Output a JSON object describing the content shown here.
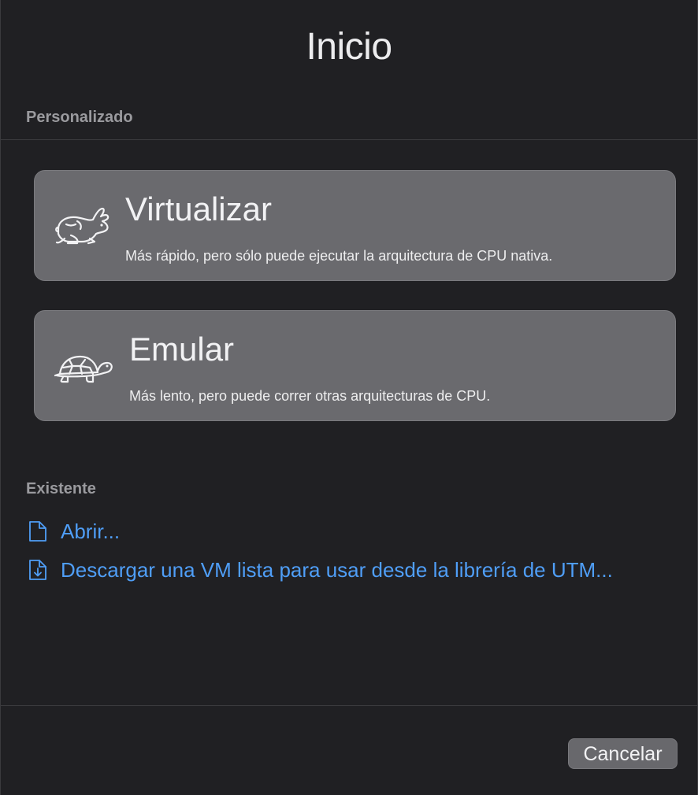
{
  "window": {
    "title": "Inicio"
  },
  "custom_section": {
    "label": "Personalizado",
    "options": [
      {
        "icon": "rabbit-icon",
        "title": "Virtualizar",
        "description": "Más rápido, pero sólo puede ejecutar la arquitectura de CPU nativa."
      },
      {
        "icon": "turtle-icon",
        "title": "Emular",
        "description": "Más lento, pero puede correr otras arquitecturas de CPU."
      }
    ]
  },
  "existing_section": {
    "label": "Existente",
    "links": [
      {
        "icon": "document-icon",
        "label": "Abrir..."
      },
      {
        "icon": "document-download-icon",
        "label": "Descargar una VM lista para usar desde la librería de UTM..."
      }
    ]
  },
  "footer": {
    "cancel_label": "Cancelar"
  },
  "colors": {
    "background": "#202023",
    "card": "#6a6a6e",
    "link": "#4f9ef7",
    "section_label": "#9a9a9e"
  }
}
